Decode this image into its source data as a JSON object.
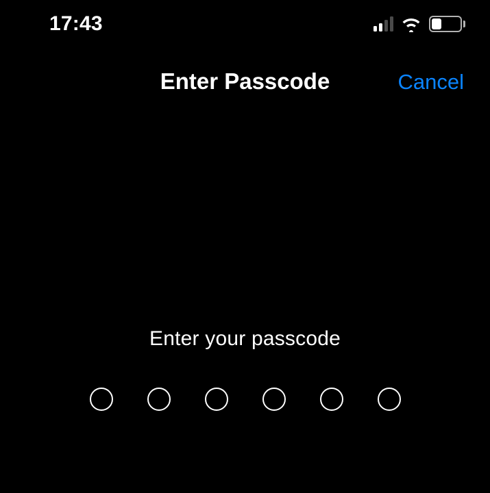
{
  "status": {
    "time": "17:43",
    "cellular_bars_active": 2,
    "battery_fraction": 0.35
  },
  "nav": {
    "title": "Enter Passcode",
    "cancel_label": "Cancel"
  },
  "prompt": {
    "label": "Enter your passcode",
    "digits_total": 6,
    "digits_entered": 0
  },
  "colors": {
    "accent": "#0a84ff",
    "background": "#000000",
    "text": "#ffffff"
  }
}
